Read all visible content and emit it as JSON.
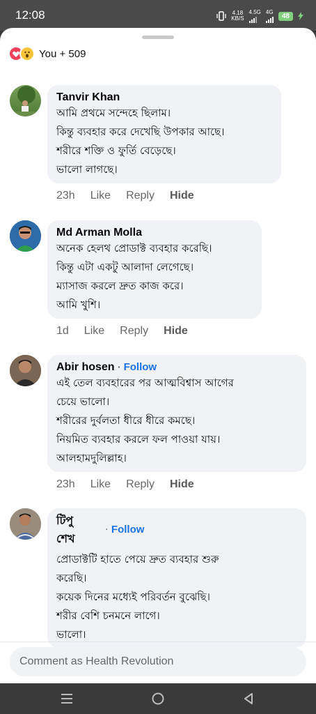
{
  "status_bar": {
    "time": "12:08",
    "net_speed_value": "4.18",
    "net_speed_unit": "KB/S",
    "network_1": "4.5G",
    "network_2": "4G",
    "battery": "48"
  },
  "reactions": {
    "summary": "You + 509",
    "icons": [
      "love-icon",
      "wow-icon"
    ]
  },
  "comments": [
    {
      "name": "Tanvir Khan",
      "lines": [
        "আমি প্রথমে সন্দেহে ছিলাম।",
        "কিন্তু ব্যবহার করে দেখেছি উপকার আছে।",
        "শরীরে শক্তি ও ফুর্তি বেড়েছে।",
        "ভালো লাগছে।"
      ],
      "time": "23h",
      "like": "Like",
      "reply": "Reply",
      "hide": "Hide"
    },
    {
      "name": "Md Arman Molla",
      "lines": [
        "অনেক হেলথ প্রোডাক্ট ব্যবহার করেছি।",
        "কিন্তু এটা একটু আলাদা লেগেছে।",
        "ম্যাসাজ করলে দ্রুত কাজ করে।",
        "আমি খুশি।"
      ],
      "time": "1d",
      "like": "Like",
      "reply": "Reply",
      "hide": "Hide"
    },
    {
      "name": "Abir hosen",
      "follow": "Follow",
      "lines": [
        "এই তেল ব্যবহারের পর আত্মবিশ্বাস আগের",
        "চেয়ে ভালো।",
        "শরীরের দুর্বলতা ধীরে ধীরে কমছে।",
        "নিয়মিত ব্যবহার করলে ফল পাওয়া যায়।",
        "আলহামদুলিল্লাহ।"
      ],
      "time": "23h",
      "like": "Like",
      "reply": "Reply",
      "hide": "Hide"
    },
    {
      "name_line1": "টিপু",
      "name_line2": "শেখ",
      "follow": "Follow",
      "lines": [
        "প্রোডাক্টটি হাতে পেয়ে দ্রুত ব্যবহার শুরু",
        "করেছি।",
        "কয়েক দিনের মধ্যেই পরিবর্তন বুঝেছি।",
        "শরীর বেশি চনমনে লাগে।",
        "ভালো।"
      ]
    }
  ],
  "composer": {
    "placeholder": "Comment as Health Revolution"
  },
  "nav": {
    "icons": [
      "menu-icon",
      "home-circle-icon",
      "back-triangle-icon"
    ]
  },
  "colors": {
    "accent": "#1b74e4",
    "bubble": "#f0f2f5",
    "love": "#f0405a",
    "wow": "#f7c43a"
  }
}
